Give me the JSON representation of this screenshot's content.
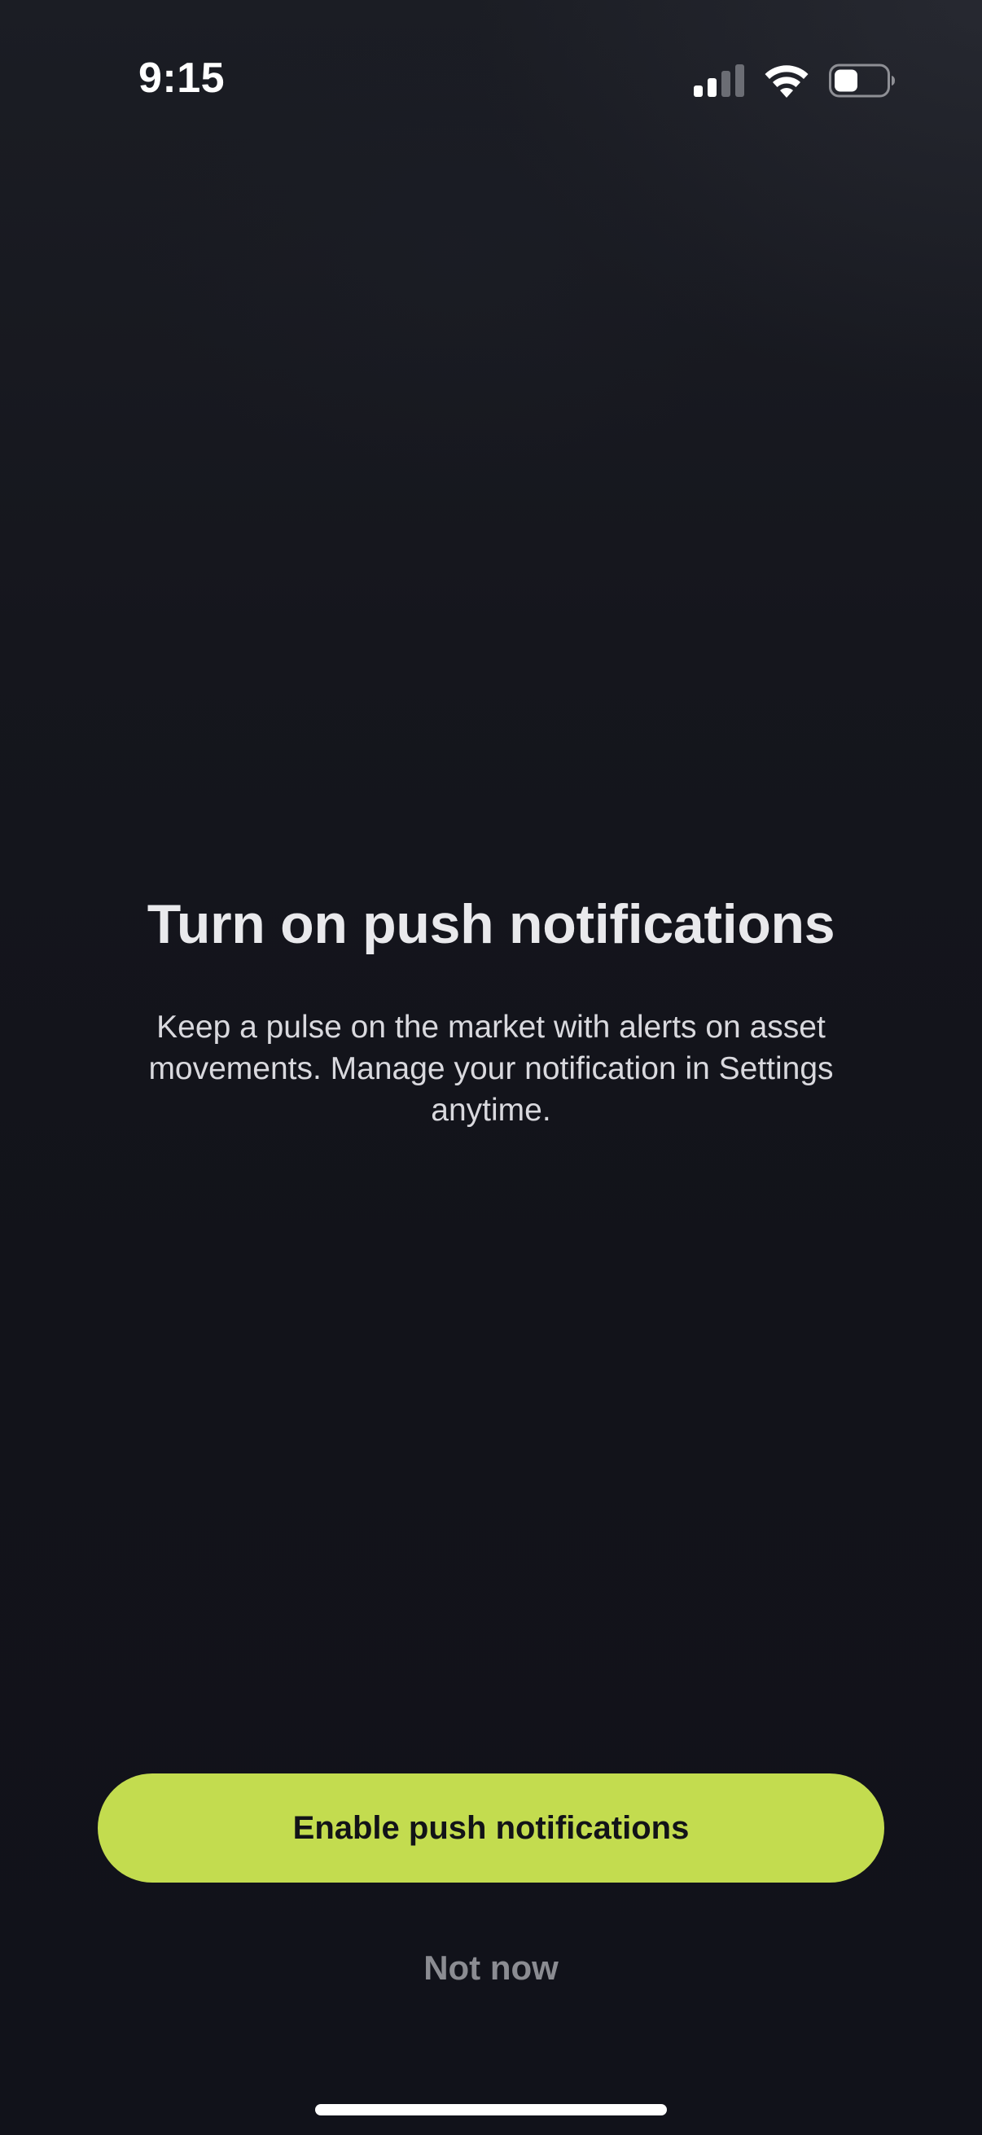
{
  "status_bar": {
    "time": "9:15",
    "icons": [
      "cellular-signal-icon",
      "wifi-icon",
      "battery-icon"
    ]
  },
  "onboarding": {
    "title": "Turn on push notifications",
    "description": "Keep a pulse on the market with alerts on asset movements. Manage your notification in Settings anytime."
  },
  "actions": {
    "primary_label": "Enable push notifications",
    "secondary_label": "Not now"
  },
  "colors": {
    "background": "#12131a",
    "accent": "#c3dc4f",
    "title_text": "#e9e9ec",
    "secondary_text": "#8b8c92"
  }
}
